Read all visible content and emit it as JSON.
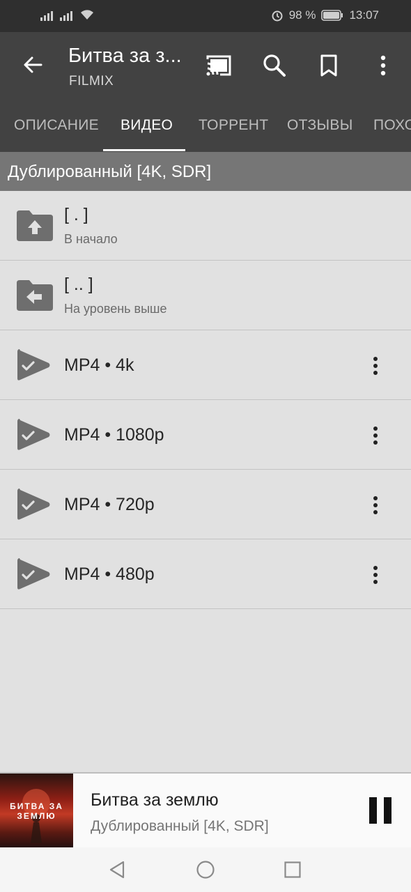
{
  "status_bar": {
    "battery": "98 %",
    "time": "13:07",
    "icons": [
      "signal-icon",
      "signal-icon",
      "wifi-icon",
      "alarm-icon",
      "battery-icon"
    ]
  },
  "toolbar": {
    "title": "Битва за з...",
    "subtitle": "FILMIX",
    "icons": [
      "back-arrow-icon",
      "cast-icon",
      "search-icon",
      "bookmark-icon",
      "more-vert-icon"
    ]
  },
  "tabs": [
    {
      "label": "ОПИСАНИЕ",
      "active": false
    },
    {
      "label": "ВИДЕО",
      "active": true
    },
    {
      "label": "ТОРРЕНТ",
      "active": false
    },
    {
      "label": "ОТЗЫВЫ",
      "active": false
    },
    {
      "label": "ПОХО",
      "active": false
    }
  ],
  "section": {
    "title": "Дублированный [4K, SDR]"
  },
  "folders": [
    {
      "name": "[ . ]",
      "caption": "В начало",
      "icon": "folder-up-icon"
    },
    {
      "name": "[ .. ]",
      "caption": "На уровень выше",
      "icon": "folder-back-icon"
    }
  ],
  "files": [
    {
      "label": "MP4 • 4k",
      "icon": "play-check-icon"
    },
    {
      "label": "MP4 • 1080p",
      "icon": "play-check-icon"
    },
    {
      "label": "MP4 • 720p",
      "icon": "play-check-icon"
    },
    {
      "label": "MP4 • 480p",
      "icon": "play-check-icon"
    }
  ],
  "player": {
    "title": "Битва за землю",
    "subtitle": "Дублированный [4K, SDR]",
    "poster_text": "БИТВА ЗА ЗЕМЛЮ"
  },
  "colors": {
    "toolbar": "#424242",
    "status_bar": "#2f2f2f",
    "section_header": "#767676",
    "list_bg": "#e1e1e1",
    "icon_gray": "#6e6e6e"
  }
}
